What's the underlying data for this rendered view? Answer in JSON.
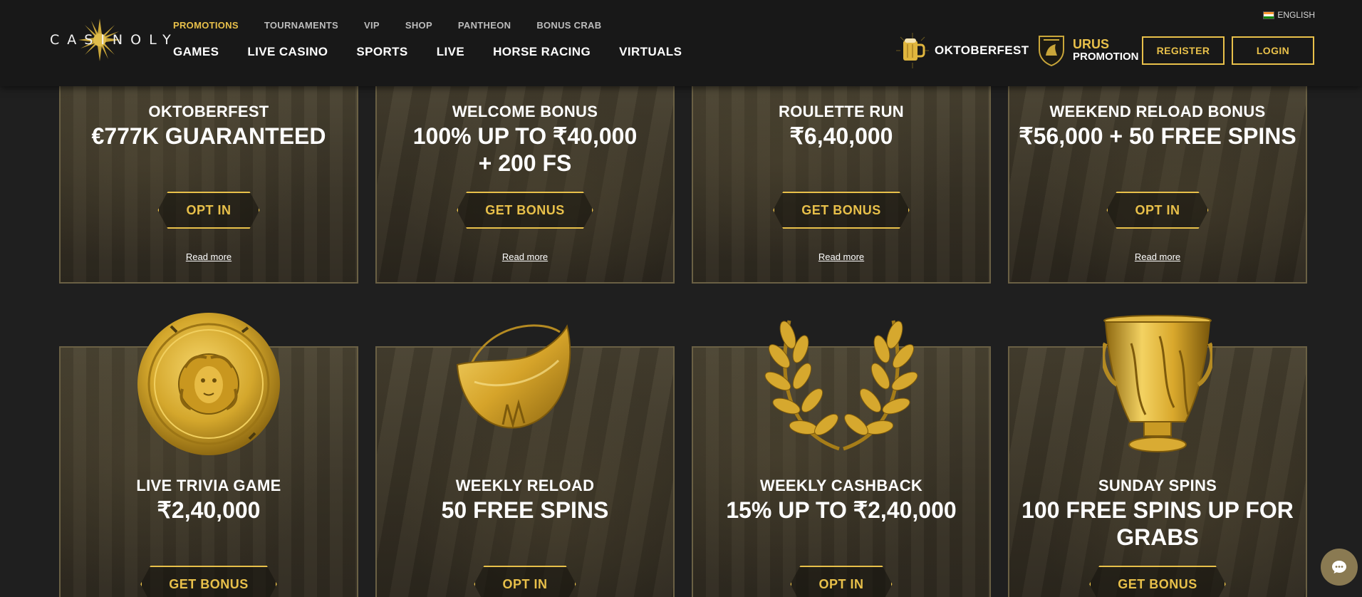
{
  "header": {
    "logo_text": "CASINOLY",
    "top_nav": [
      {
        "label": "PROMOTIONS",
        "active": true
      },
      {
        "label": "TOURNAMENTS",
        "active": false
      },
      {
        "label": "VIP",
        "active": false
      },
      {
        "label": "SHOP",
        "active": false
      },
      {
        "label": "PANTHEON",
        "active": false
      },
      {
        "label": "BONUS CRAB",
        "active": false
      }
    ],
    "main_nav": [
      "GAMES",
      "LIVE CASINO",
      "SPORTS",
      "LIVE",
      "HORSE RACING",
      "VIRTUALS"
    ],
    "language": "ENGLISH",
    "promo_okto": "OKTOBERFEST",
    "promo_urus_line1": "URUS",
    "promo_urus_line2": "PROMOTION",
    "register_label": "REGISTER",
    "login_label": "LOGIN"
  },
  "colors": {
    "accent": "#e8c04a",
    "header_bg": "#181818",
    "page_bg": "#1f1f1f",
    "card_border": "#6a6044"
  },
  "promotions_row1": [
    {
      "name": "OKTOBERFEST",
      "amount_line1": "€777K GUARANTEED",
      "amount_line2": "",
      "cta": "OPT IN",
      "read_more": "Read more"
    },
    {
      "name": "WELCOME BONUS",
      "amount_line1": "100% UP TO ₹40,000",
      "amount_line2": "+ 200 FS",
      "cta": "GET BONUS",
      "read_more": "Read more"
    },
    {
      "name": "ROULETTE RUN",
      "amount_line1": "₹6,40,000",
      "amount_line2": "",
      "cta": "GET BONUS",
      "read_more": "Read more"
    },
    {
      "name": "WEEKEND RELOAD BONUS",
      "amount_line1": "₹56,000 + 50 FREE SPINS",
      "amount_line2": "",
      "cta": "OPT IN",
      "read_more": "Read more"
    }
  ],
  "promotions_row2": [
    {
      "name": "LIVE TRIVIA GAME",
      "amount_line1": "₹2,40,000",
      "amount_line2": "",
      "cta": "GET BONUS",
      "art": "gold-shield-icon"
    },
    {
      "name": "WEEKLY RELOAD",
      "amount_line1": "50 FREE SPINS",
      "amount_line2": "",
      "cta": "OPT IN",
      "art": "gold-pendant-icon"
    },
    {
      "name": "WEEKLY CASHBACK",
      "amount_line1": "15% UP TO ₹2,40,000",
      "amount_line2": "",
      "cta": "OPT IN",
      "art": "laurel-wreath-icon"
    },
    {
      "name": "SUNDAY SPINS",
      "amount_line1": "100 FREE SPINS UP FOR",
      "amount_line2": "GRABS",
      "cta": "GET BONUS",
      "art": "gold-vase-icon"
    }
  ],
  "chat_icon": "chat-bubble-icon"
}
